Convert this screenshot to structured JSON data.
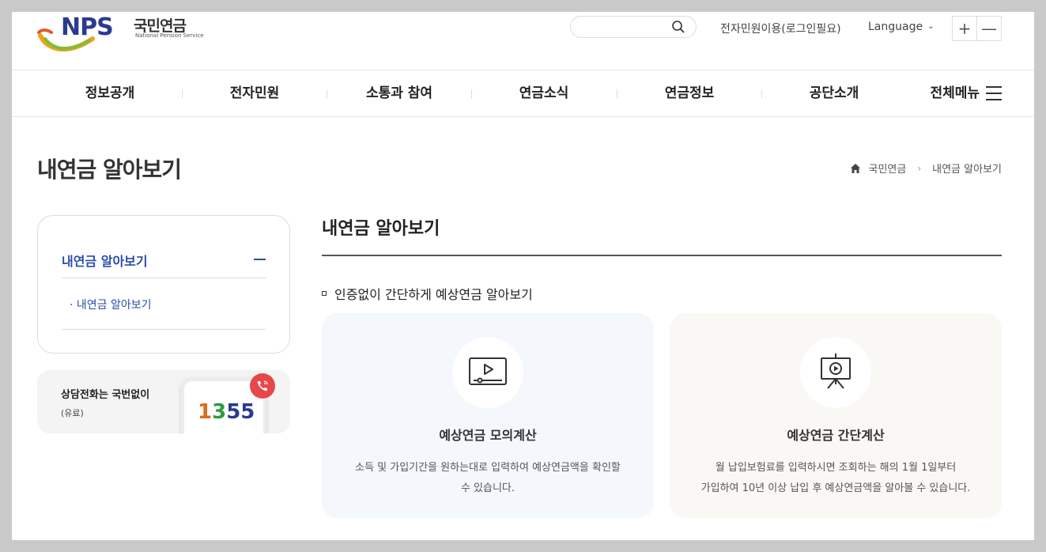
{
  "header": {
    "brand_short": "NPS",
    "brand_name": "국민연금",
    "brand_english": "National Pension Service",
    "civil_link": "전자민원이용(로그인필요)",
    "language": "Language",
    "zoom_in": "+",
    "zoom_out": "—"
  },
  "gnb": {
    "items": [
      "정보공개",
      "전자민원",
      "소통과 참여",
      "연금소식",
      "연금정보",
      "공단소개",
      "전체메뉴"
    ]
  },
  "page": {
    "title": "내연금 알아보기",
    "breadcrumb": [
      "국민연금",
      "내연금 알아보기"
    ]
  },
  "sidebar": {
    "title": "내연금 알아보기",
    "items": [
      "· 내연금 알아보기"
    ],
    "call": {
      "title": "상담전화는 국번없이",
      "sub": "(유료)",
      "number_parts": [
        "1",
        "3",
        "55"
      ]
    }
  },
  "main": {
    "title": "내연금 알아보기",
    "section_heading": "인증없이 간단하게 예상연금 알아보기",
    "cards": [
      {
        "title": "예상연금 모의계산",
        "desc_line1": "소득 및 가입기간을 원하는대로 입력하여 예상연금액을 확인할",
        "desc_line2": "수 있습니다.",
        "icon": "video-play-icon"
      },
      {
        "title": "예상연금 간단계산",
        "desc_line1": "월 납입보험료를 입력하시면 조회하는 해의 1월 1일부터",
        "desc_line2": "가입하여 10년 이상 납입 후 예상연금액을 알아볼 수 있습니다.",
        "icon": "presentation-play-icon"
      }
    ]
  },
  "colors": {
    "brand_blue": "#2b3a8f",
    "accent_blue": "#2b4cab",
    "call_red": "#e8474a"
  }
}
